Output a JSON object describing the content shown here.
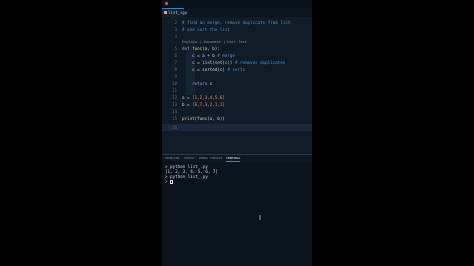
{
  "tab": {
    "label": "list_.py",
    "close": "×"
  },
  "code_lines": [
    {
      "n": "2",
      "text": "# find an merge, remove duplicate from list",
      "cls": "cmt"
    },
    {
      "n": "3",
      "text": "# and sort the list",
      "cls": "cmt"
    },
    {
      "n": "4",
      "text": ""
    },
    {
      "n": "5",
      "kw": "def ",
      "fn": "func",
      "rest": "(a, b):"
    },
    {
      "n": "6",
      "text": "    c = a + b ",
      "cmt": "# merge"
    },
    {
      "n": "7",
      "text": "    c = list(set(c)) ",
      "cmt": "# removes duplicates"
    },
    {
      "n": "8",
      "text": "    c = sorted(c) ",
      "cmt": "# sorts"
    },
    {
      "n": "9",
      "text": ""
    },
    {
      "n": "10",
      "kw": "    return ",
      "rest": "c"
    },
    {
      "n": "11",
      "text": ""
    },
    {
      "n": "12",
      "text": "a = ",
      "num": "[1,2,3,4,5,6]"
    },
    {
      "n": "13",
      "text": "b = ",
      "num": "[6,7,3,2,1,1]"
    },
    {
      "n": "14",
      "text": ""
    },
    {
      "n": "15",
      "fn": "print",
      "rest": "(func(a, b))"
    },
    {
      "n": "16",
      "text": ""
    }
  ],
  "codelens": "Explain | Document | Unit Test",
  "panel_tabs": [
    "PROBLEMS",
    "OUTPUT",
    "DEBUG CONSOLE",
    "TERMINAL"
  ],
  "terminal_lines": [
    "> python list_.py",
    "[1, 2, 3, 4, 5, 6, 7]",
    "> python list_.py",
    "> "
  ]
}
